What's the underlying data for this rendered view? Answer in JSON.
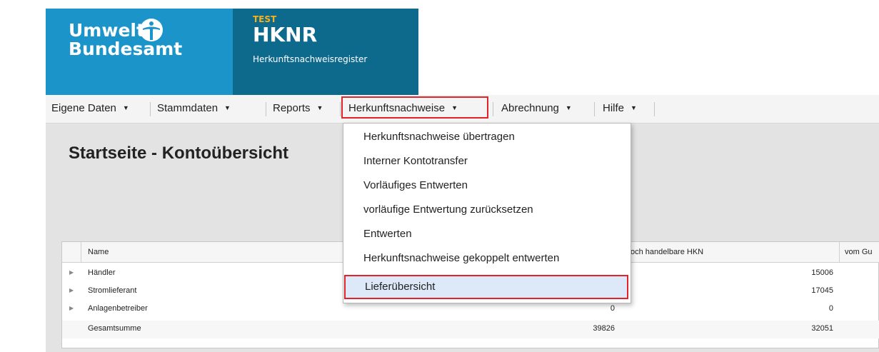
{
  "header": {
    "uba_line1": "Umwelt",
    "uba_line2": "Bundesamt",
    "test_label": "TEST",
    "app_title": "HKNR",
    "app_subtitle": "Herkunftsnachweisregister"
  },
  "menubar": {
    "items": [
      {
        "label": "Eigene Daten"
      },
      {
        "label": "Stammdaten"
      },
      {
        "label": "Reports"
      },
      {
        "label": "Herkunftsnachweise"
      },
      {
        "label": "Abrechnung"
      },
      {
        "label": "Hilfe"
      }
    ]
  },
  "page": {
    "title": "Startseite - Kontoübersicht"
  },
  "grid": {
    "columns": [
      "Name",
      "och handelbare HKN",
      "vom Gu"
    ],
    "rows": [
      {
        "name": "Händler",
        "c1": "",
        "c2": "15006"
      },
      {
        "name": "Stromlieferant",
        "c1": "",
        "c2": "17045"
      },
      {
        "name": "Anlagenbetreiber",
        "c1": "0",
        "c2": "0"
      }
    ],
    "total": {
      "name": "Gesamtsumme",
      "c1": "39826",
      "c2": "32051"
    }
  },
  "dropdown": {
    "items": [
      {
        "label": "Herkunftsnachweise übertragen"
      },
      {
        "label": "Interner Kontotransfer"
      },
      {
        "label": "Vorläufiges Entwerten"
      },
      {
        "label": "vorläufige Entwertung zurücksetzen"
      },
      {
        "label": "Entwerten"
      },
      {
        "label": "Herkunftsnachweise gekoppelt entwerten"
      },
      {
        "label": "Lieferübersicht"
      }
    ]
  },
  "colors": {
    "uba_blue": "#1a94c9",
    "hknr_teal": "#0e6a8c",
    "test_orange": "#f6b21c",
    "highlight_red": "#e2242a"
  }
}
